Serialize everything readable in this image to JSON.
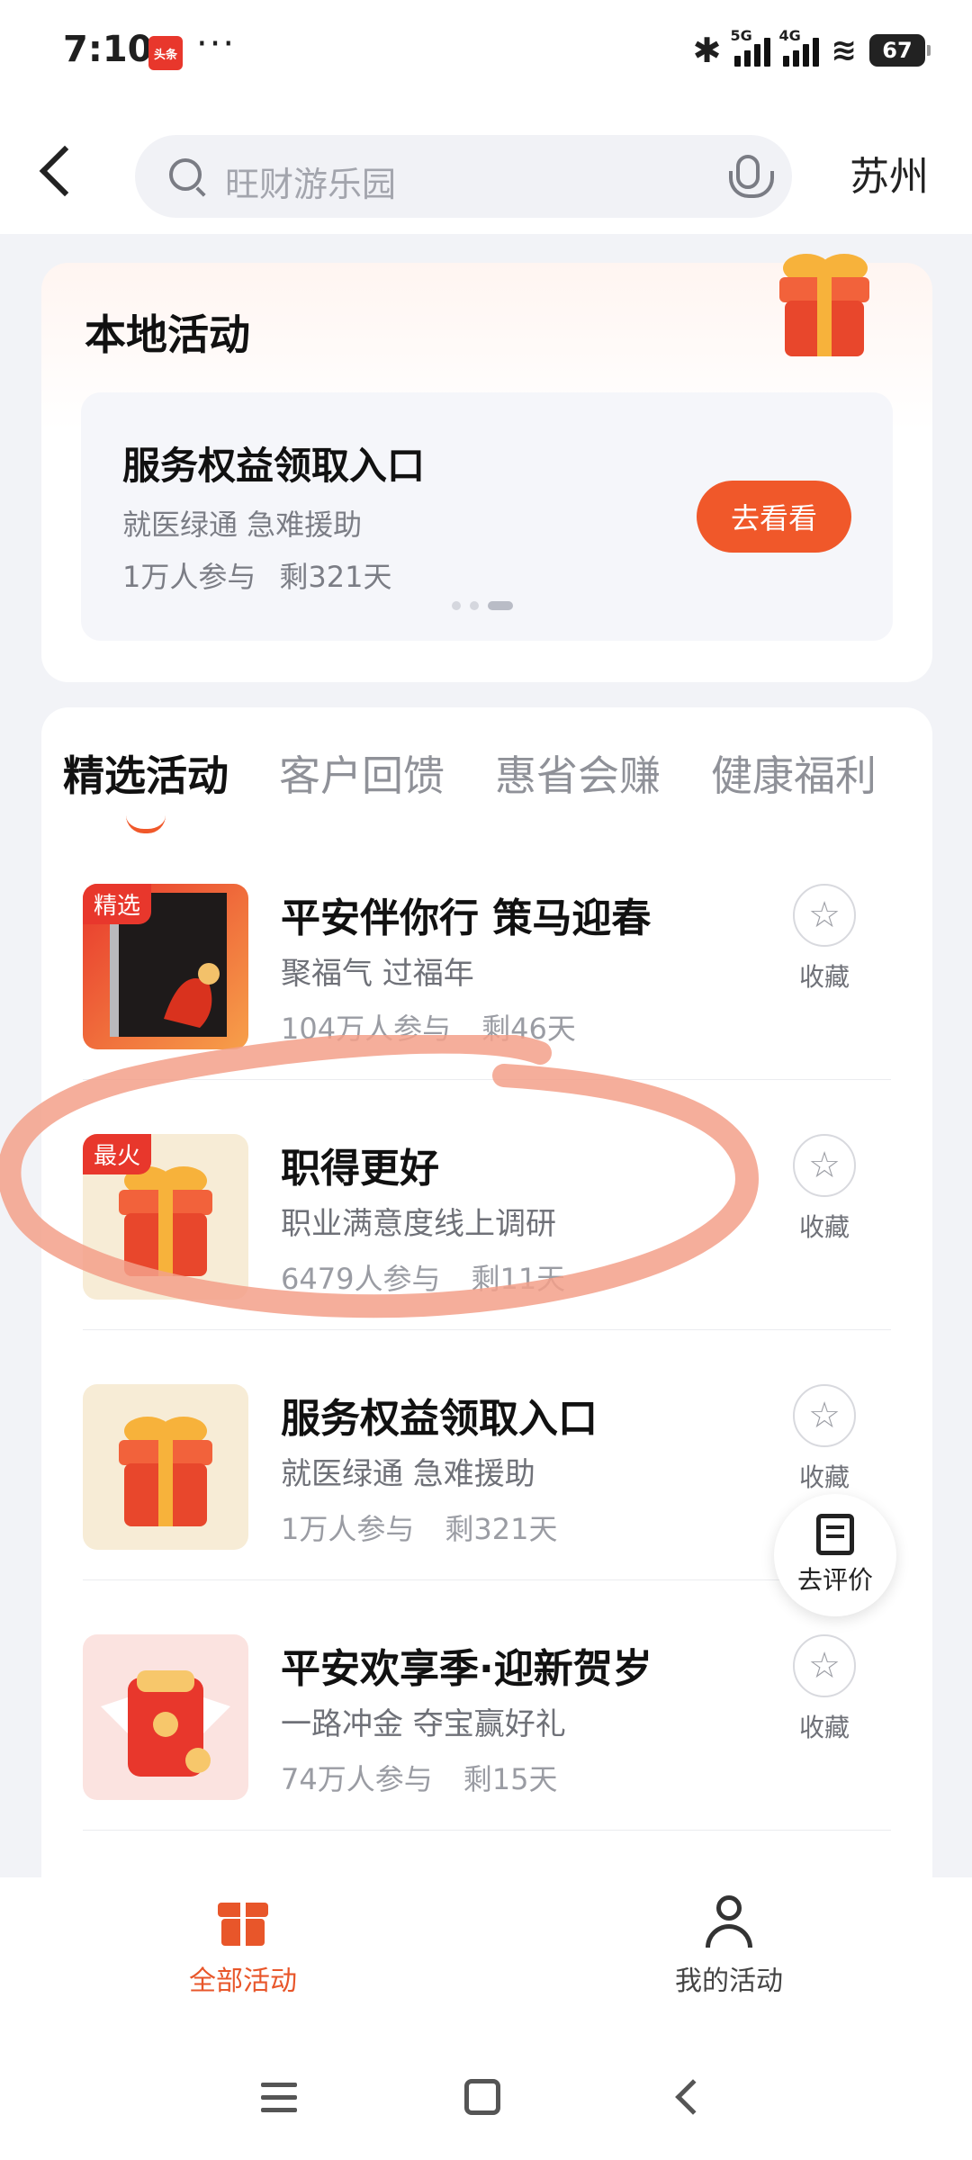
{
  "status_bar": {
    "time": "7:10",
    "app_badge": "头条",
    "more": "···",
    "bluetooth": "✱",
    "signal1_tag": "5G",
    "signal2_tag": "4G",
    "wifi": "≋",
    "battery": "67"
  },
  "header": {
    "search_placeholder": "旺财游乐园",
    "city": "苏州"
  },
  "local": {
    "title": "本地活动",
    "card": {
      "title": "服务权益领取入口",
      "subtitle": "就医绿通 急难援助",
      "participants": "1万人参与",
      "remaining": "剩321天",
      "button": "去看看"
    }
  },
  "tabs": [
    "精选活动",
    "客户回馈",
    "惠省会赚",
    "健康福利"
  ],
  "items": [
    {
      "badge": "精选",
      "title": "平安伴你行 策马迎春",
      "subtitle": "聚福气 过福年",
      "participants": "104万人参与",
      "remaining": "剩46天",
      "fav": "收藏"
    },
    {
      "badge": "最火",
      "title": "职得更好",
      "subtitle": "职业满意度线上调研",
      "participants": "6479人参与",
      "remaining": "剩11天",
      "fav": "收藏"
    },
    {
      "badge": "",
      "title": "服务权益领取入口",
      "subtitle": "就医绿通 急难援助",
      "participants": "1万人参与",
      "remaining": "剩321天",
      "fav": "收藏"
    },
    {
      "badge": "",
      "title": "平安欢享季·迎新贺岁",
      "subtitle": "一路冲金 夺宝赢好礼",
      "participants": "74万人参与",
      "remaining": "剩15天",
      "fav": "收藏"
    }
  ],
  "eval_button": "去评价",
  "bottom_nav": {
    "all": "全部活动",
    "mine": "我的活动"
  },
  "colors": {
    "accent": "#f0582a",
    "badge_red": "#e8372c",
    "annotation": "#f3a08a"
  }
}
